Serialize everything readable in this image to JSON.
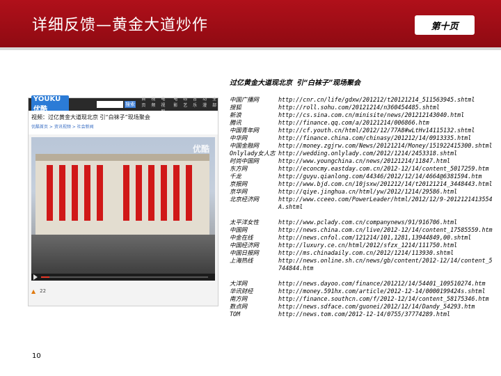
{
  "header": {
    "title": "详细反馈—黄金大道炒作",
    "page_label": "第十页"
  },
  "subtitle": "过亿黄金大道现北京 引“白袜子”现场聚会",
  "screenshot": {
    "site_logo": "YOUKU 优酷",
    "search_button": "搜索",
    "nav": [
      "首页",
      "视频",
      "电视剧",
      "电影",
      "综艺",
      "音乐",
      "动漫",
      "全部"
    ],
    "video_title": "视频：过亿黄金大道现北京 引“白袜子”现场聚会",
    "breadcrumb": "优酷首页 > 资讯视频 > 社会新闻",
    "watermark": "优酷",
    "progress": 0.05,
    "vote_count": "22"
  },
  "link_groups": [
    [
      {
        "name": "中国广播网",
        "url": "http://cnr.cn/life/gdxw/201212/t20121214_511563945.shtml"
      },
      {
        "name": "搜狐",
        "url": "http://roll.sohu.com/20121214/n360454485.shtml"
      },
      {
        "name": "新浪",
        "url": "http://cs.sina.com.cn/minisite/news/201212143040.html"
      },
      {
        "name": "腾讯",
        "url": "http://finance.qq.com/a/20121214/006866.htm"
      },
      {
        "name": "中国青年网",
        "url": "http://cf.youth.cn/html/2012/12/77A8#wLtHv14115132.shtml"
      },
      {
        "name": "中华网",
        "url": "http://finance.china.com/chinasy/201212/14/0913335.html"
      },
      {
        "name": "中国金融网",
        "url": "http://money.zgjrw.com/News/20121214/Money/151922415300.shtml"
      },
      {
        "name": "Onlylady女人志",
        "url": "http://wedding.onlylady.com/2012/1214/2453318.shtml"
      },
      {
        "name": "时尚中国网",
        "url": "http://www.youngchina.cn/news/20121214/11847.html"
      },
      {
        "name": "东方网",
        "url": "http://econcmy.eastday.com.cn/2012-12/14/content_5017259.htm"
      },
      {
        "name": "千龙",
        "url": "http://guyu.qianlong.com/44346/2012/12/14/4664@6381594.htm"
      },
      {
        "name": "京报网",
        "url": "http://www.bjd.com.cn/10jsxw/201212/14/t20121214_3448443.html"
      },
      {
        "name": "京华网",
        "url": "http://qiye.jinghua.cn/html/yw/2012/1214/29586.html"
      },
      {
        "name": "北京经济网",
        "url": "http://www.cceeo.com/PowerLeader/html/2012/12/9-2012121413554A.shtml"
      }
    ],
    [
      {
        "name": "太平洋女性",
        "url": "http://www.pclady.com.cn/companynews/91/916706.html"
      },
      {
        "name": "中国网",
        "url": "http://news.china.com.cn/live/2012-12/14/content_17585559.htm"
      },
      {
        "name": "中金在线",
        "url": "http://news.cnfol.com/121214/101,1281,13944849,00.shtml"
      },
      {
        "name": "中国经济网",
        "url": "http://luxury.ce.cn/html/2012/sfzx_1214/111750.html"
      },
      {
        "name": "中国日报网",
        "url": "http://ms.chinadaily.com.cn/2012/1214/113930.shtml"
      },
      {
        "name": "上海热线",
        "url": "http://news.online.sh.cn/news/gb/content/2012-12/14/content_5744844.htm"
      }
    ],
    [
      {
        "name": "大洋网",
        "url": "http://news.dayoo.com/finance/201212/14/54401_109510274.htm"
      },
      {
        "name": "华讯财经",
        "url": "http://money.591hx.com/article/2012-12-14/0000199424s.shtml"
      },
      {
        "name": "南方网",
        "url": "http://finance.southcn.com/f/2012-12/14/content_58175346.htm"
      },
      {
        "name": "数点网",
        "url": "http://news.sdface.com/guonei/2012/12/14/Dandy_54293.htm"
      },
      {
        "name": "TOM",
        "url": "http://news.tom.com/2012-12-14/0755/37774289.html"
      }
    ]
  ],
  "page_number": "10"
}
